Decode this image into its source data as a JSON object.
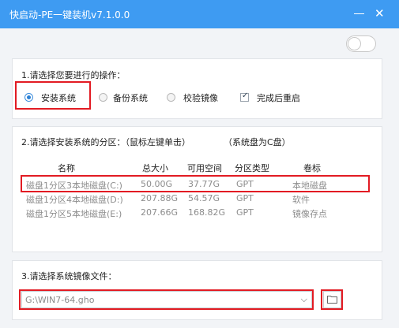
{
  "window": {
    "title": "快启动-PE一键装机v7.1.0.0",
    "minimize_icon": "minimize-icon",
    "close_icon": "close-icon",
    "close_glyph": "✕",
    "accent": "#3e9bf2"
  },
  "toggle": {
    "state": "off"
  },
  "operation": {
    "title": "1.请选择您要进行的操作：",
    "options": [
      "安装系统",
      "备份系统",
      "校验镜像"
    ],
    "selected": "安装系统",
    "restart_checkbox": {
      "label": "完成后重启",
      "checked": true,
      "mark": "✓"
    }
  },
  "partition": {
    "title": "2.请选择安装系统的分区：（鼠标左键单击）",
    "note": "（系统盘为C盘）",
    "columns": [
      "名称",
      "总大小",
      "可用空间",
      "分区类型",
      "卷标"
    ],
    "rows": [
      [
        "磁盘1分区3本地磁盘(C:)",
        "50.00G",
        "37.77G",
        "GPT",
        "本地磁盘"
      ],
      [
        "磁盘1分区4本地磁盘(D:)",
        "207.88G",
        "54.57G",
        "GPT",
        "软件"
      ],
      [
        "磁盘1分区5本地磁盘(E:)",
        "207.66G",
        "168.82G",
        "GPT",
        "镜像存点"
      ]
    ],
    "selected_row": 0
  },
  "image": {
    "title": "3.请选择系统镜像文件：",
    "file": "G:\\WIN7-64.gho",
    "dropdown_arrow": "⌵",
    "browse_icon": "folder-icon"
  },
  "highlight_color": "#e21b23"
}
